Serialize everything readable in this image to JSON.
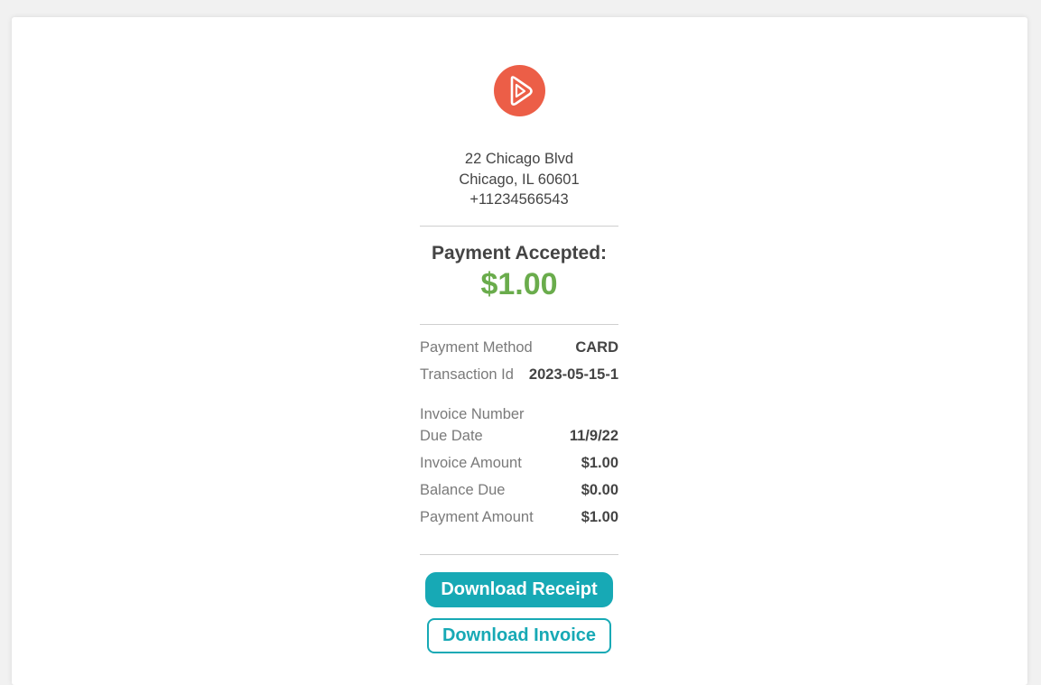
{
  "merchant": {
    "logo_icon": "play-logo-icon",
    "brand_color": "#ec5e47",
    "address_line1": "22 Chicago Blvd",
    "address_line2": "Chicago, IL 60601",
    "phone": "+11234566543"
  },
  "payment": {
    "heading": "Payment Accepted:",
    "amount": "$1.00",
    "amount_color": "#6aac4c"
  },
  "details": {
    "method_label": "Payment Method",
    "method_value": "CARD",
    "transaction_label": "Transaction Id",
    "transaction_value": "2023-05-15-1",
    "invoice_number_label": "Invoice Number",
    "due_date_label": "Due Date",
    "due_date_value": "11/9/22",
    "invoice_amount_label": "Invoice Amount",
    "invoice_amount_value": "$1.00",
    "balance_due_label": "Balance Due",
    "balance_due_value": "$0.00",
    "payment_amount_label": "Payment Amount",
    "payment_amount_value": "$1.00"
  },
  "actions": {
    "download_receipt": "Download Receipt",
    "download_invoice": "Download Invoice",
    "accent_color": "#17a9b5"
  }
}
